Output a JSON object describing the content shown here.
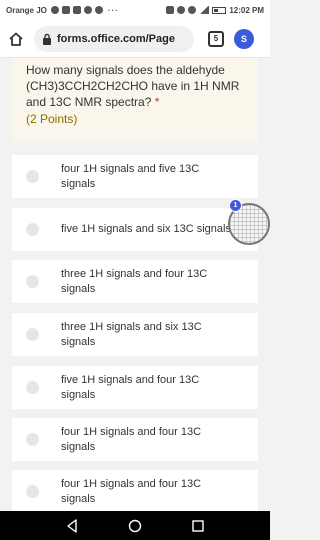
{
  "status_bar": {
    "carrier": "Orange JO",
    "time": "12:02 PM",
    "more": "···"
  },
  "browser": {
    "url": "forms.office.com/Page",
    "tab_count": "5",
    "extension_label": "S"
  },
  "question": {
    "text": "How many signals does the aldehyde (CH3)3CCH2CH2CHO have in 1H NMR and 13C NMR spectra?",
    "required_mark": "*",
    "points": "(2 Points)"
  },
  "options": [
    {
      "label": "four 1H signals and five 13C signals"
    },
    {
      "label": "five 1H signals and six 13C signals"
    },
    {
      "label": "three 1H signals and four 13C signals"
    },
    {
      "label": "three 1H signals and six 13C signals"
    },
    {
      "label": "five 1H signals and four 13C signals"
    },
    {
      "label": "four 1H signals and four 13C signals"
    },
    {
      "label": "four 1H signals and four 13C signals"
    }
  ],
  "floating_widget": {
    "badge": "1"
  },
  "colors": {
    "question_bg": "#fbf6ec",
    "points_color": "#8a6d00",
    "required_color": "#c0392b",
    "accent": "#3b5bdb"
  }
}
